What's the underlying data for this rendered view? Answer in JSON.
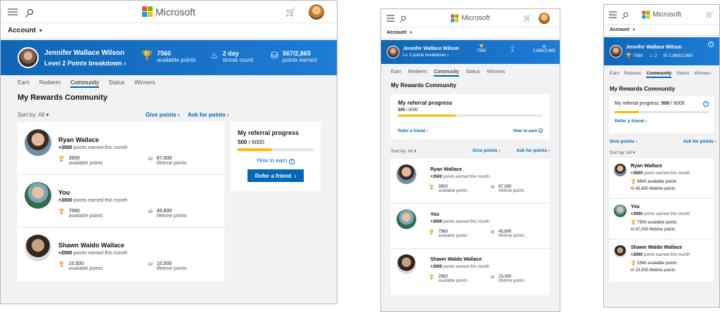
{
  "brand": {
    "name": "Microsoft",
    "colors": {
      "red": "#f25022",
      "green": "#7fba00",
      "blue": "#00a4ef",
      "yellow": "#ffb900",
      "accent": "#0067b8",
      "banner": "#1170c4"
    }
  },
  "icons": {
    "menu": "hamburger-icon",
    "search": "search-icon",
    "cart": "cart-icon",
    "trophy": "trophy-icon",
    "flame": "flame-icon",
    "coins": "coins-icon",
    "info": "info-icon"
  },
  "account_label": "Account",
  "user": {
    "name": "Jennifer Wallace Wilson",
    "level_desktop": "Level 2 Points breakdown",
    "level_tablet": "Lv. 2 points breakdown"
  },
  "stats": {
    "available": {
      "value": "7560",
      "label": "available points"
    },
    "streak": {
      "value_desktop": "2 day",
      "value_short": "2",
      "label": "streak count"
    },
    "earned": {
      "value_desktop": "567/2,865",
      "value_tablet": "2,865/2,865",
      "label": "points earned"
    }
  },
  "tabs": [
    "Earn",
    "Redeem",
    "Community",
    "Status",
    "Winners"
  ],
  "active_tab": "Community",
  "page_title": "My Rewards Community",
  "sort": "Sort by: All",
  "give_points": "Give points",
  "ask_points": "Ask for points",
  "referral": {
    "title": "My referral progress",
    "title_mobile": "My referral progress:",
    "value": "500",
    "total": "/ 6000",
    "progress": 0.083,
    "how_to_earn": "How to earn",
    "refer_button": "Refer a friend",
    "refer_link": "Refer a friend"
  },
  "members_desktop": [
    {
      "name": "Ryan Wallace",
      "earned": "+3500",
      "earned_suffix": " points earned this month",
      "available": "3500",
      "lifetime": "87,000"
    },
    {
      "name": "You",
      "earned": "+3000",
      "earned_suffix": " points earned this month",
      "available": "7560",
      "lifetime": "45,600"
    },
    {
      "name": "Shawn Waldo Wallace",
      "earned": "+2500",
      "earned_suffix": " points earned this month",
      "available": "10,500",
      "lifetime": "10,500"
    }
  ],
  "members_tablet": [
    {
      "name": "Ryan Wallace",
      "earned": "+3500",
      "earned_suffix": " points earned this month",
      "available": "3500",
      "lifetime": "87,000"
    },
    {
      "name": "You",
      "earned": "+3000",
      "earned_suffix": " points earned this month",
      "available": "7560",
      "lifetime": "45,600"
    },
    {
      "name": "Shawn Waldo Wallace",
      "earned": "+2000",
      "earned_suffix": " points earned this month",
      "available": "2560",
      "lifetime": "23,000"
    }
  ],
  "members_mobile": [
    {
      "name": "Ryan Wallace",
      "earned": "+3500",
      "earned_suffix": " points earned this month",
      "available": "8600",
      "lifetime": "45,660"
    },
    {
      "name": "You",
      "earned": "+3000",
      "earned_suffix": " points earned this month",
      "available": "7500",
      "lifetime": "87,000"
    },
    {
      "name": "Shawn Waldo Wallace",
      "earned": "+2000",
      "earned_suffix": " points earned this month",
      "available": "2560",
      "lifetime": "23,000"
    }
  ],
  "labels": {
    "available": "available points",
    "lifetime": "lifetime points",
    "available_mobile": " available points",
    "lifetime_mobile": " lifetime points"
  }
}
